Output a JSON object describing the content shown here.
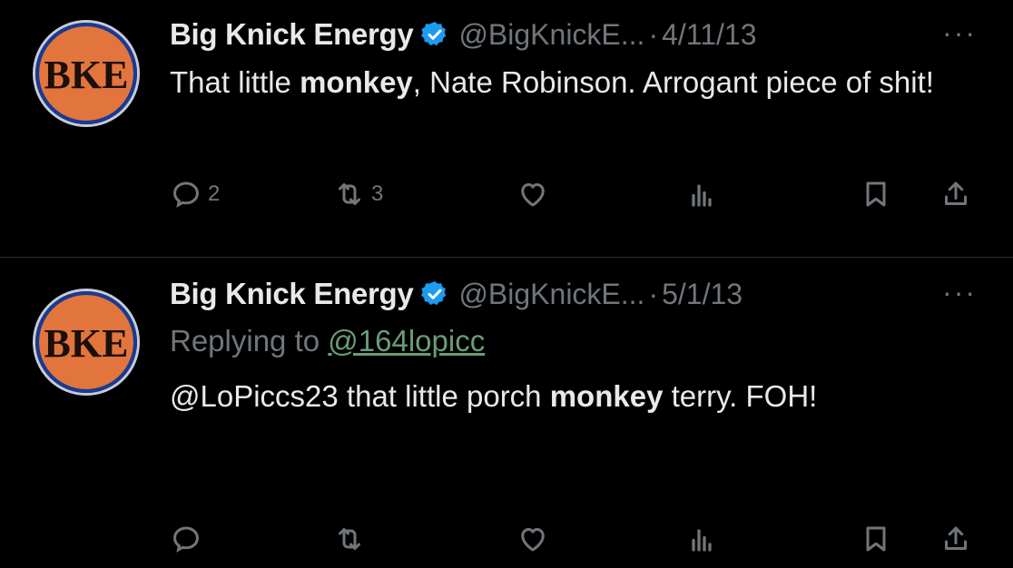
{
  "tweets": [
    {
      "avatar_text": "BKE",
      "name": "Big Knick Energy",
      "handle": "@BigKnickE...",
      "separator": "·",
      "date": "4/11/13",
      "more": "···",
      "text_parts": [
        "That little ",
        "monkey",
        ", Nate Robinson. Arrogant piece of shit!"
      ],
      "reply_count": "2",
      "retweet_count": "3"
    },
    {
      "avatar_text": "BKE",
      "name": "Big Knick Energy",
      "handle": "@BigKnickE...",
      "separator": "·",
      "date": "5/1/13",
      "more": "···",
      "replying_label": "Replying to ",
      "replying_to": "@164lopicc",
      "text_parts": [
        "@LoPiccs23 that little porch ",
        "monkey",
        " terry. FOH!"
      ]
    }
  ],
  "colors": {
    "background": "#000000",
    "text": "#e7e9ea",
    "muted": "#71767b",
    "verified": "#1d9bf0",
    "avatar_orange": "#e2753d",
    "avatar_blue": "#1a3a8f"
  }
}
